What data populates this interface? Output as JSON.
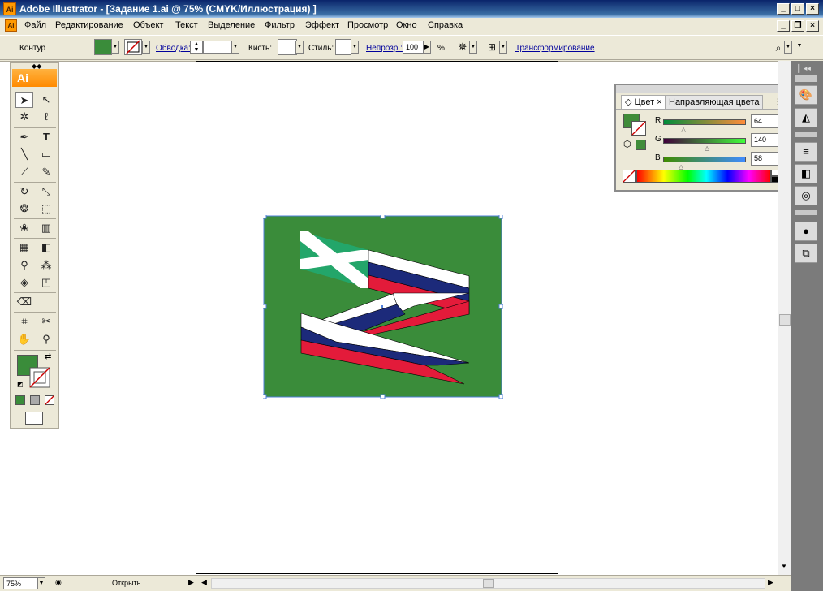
{
  "window": {
    "title": "Adobe Illustrator - [Задание 1.ai @ 75% (CMYK/Иллюстрация) ]",
    "app_icon": "Ai"
  },
  "menu": {
    "items": [
      "Файл",
      "Редактирование",
      "Объект",
      "Текст",
      "Выделение",
      "Фильтр",
      "Эффект",
      "Просмотр",
      "Окно",
      "Справка"
    ]
  },
  "control_bar": {
    "contour_label": "Контур",
    "stroke_link": "Обводка:",
    "brush_label": "Кисть:",
    "style_label": "Стиль:",
    "opacity_link": "Непрозр.:",
    "opacity_value": "100",
    "opacity_unit": "%",
    "transform_link": "Трансформирование",
    "fill_color": "#3a8c3a"
  },
  "toolbox": {
    "header": "Ai",
    "fill_color": "#3a8c3a"
  },
  "color_panel": {
    "tab_color": "Цвет",
    "tab_guide": "Направляющая цвета",
    "r_label": "R",
    "g_label": "G",
    "b_label": "B",
    "r_value": "64",
    "g_value": "140",
    "b_value": "58",
    "swatch_color": "#408c3a"
  },
  "status_bar": {
    "zoom": "75%",
    "status": "Открыть"
  },
  "artwork": {
    "background_color": "#3a8c3a",
    "colors": [
      "#ffffff",
      "#1c2a7a",
      "#e31b3a",
      "#23a66a"
    ]
  }
}
